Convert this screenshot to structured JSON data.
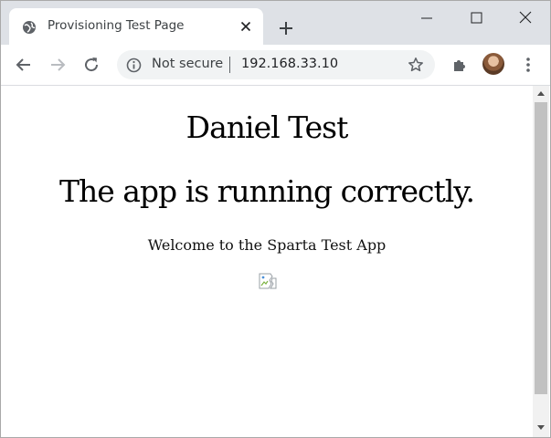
{
  "browser": {
    "tab": {
      "title": "Provisioning Test Page"
    },
    "omnibox": {
      "security_label": "Not secure",
      "url": "192.168.33.10"
    }
  },
  "page": {
    "heading_name": "Daniel Test",
    "heading_status": "The app is running correctly.",
    "welcome_text": "Welcome to the Sparta Test App"
  },
  "icons": {
    "favicon": "globe-icon",
    "tab_close": "close-icon",
    "new_tab": "plus-icon",
    "back": "arrow-left-icon",
    "forward": "arrow-right-icon",
    "reload": "reload-icon",
    "info": "info-icon",
    "bookmark": "star-icon",
    "extensions": "puzzle-icon",
    "menu": "kebab-menu-icon",
    "broken_image": "broken-image-icon"
  },
  "colors": {
    "tabstrip": "#dee1e6",
    "omnibox": "#f1f3f4",
    "scrollbar_thumb": "#c1c1c1"
  }
}
